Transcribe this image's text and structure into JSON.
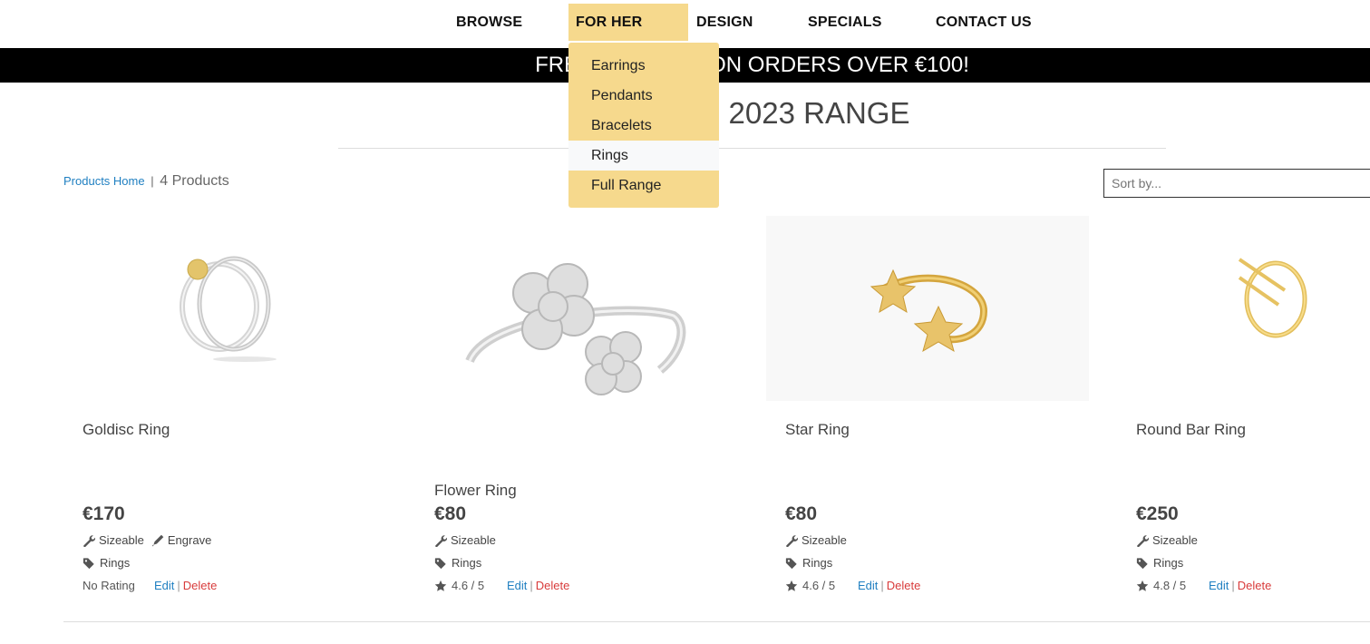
{
  "nav": {
    "items": [
      "BROWSE",
      "FOR HER",
      "DESIGN",
      "SPECIALS",
      "CONTACT US"
    ]
  },
  "dropdown": {
    "items": [
      "Earrings",
      "Pendants",
      "Bracelets",
      "Rings",
      "Full Range"
    ],
    "active": "Rings"
  },
  "banner": {
    "text": "FREE SHIPPING ON ORDERS OVER €100!"
  },
  "range": {
    "title": "2023 RANGE"
  },
  "breadcrumb": {
    "link": "Products Home",
    "sep": "|",
    "count": "4 Products"
  },
  "sort": {
    "placeholder": "Sort by..."
  },
  "actions": {
    "edit": "Edit",
    "sep": "|",
    "delete": "Delete"
  },
  "products": [
    {
      "name": "Goldisc Ring",
      "price": "€170",
      "features": [
        "Sizeable",
        "Engrave"
      ],
      "category": "Rings",
      "rating": "No Rating"
    },
    {
      "name": "Flower Ring",
      "price": "€80",
      "features": [
        "Sizeable"
      ],
      "category": "Rings",
      "rating": "4.6 / 5"
    },
    {
      "name": "Star Ring",
      "price": "€80",
      "features": [
        "Sizeable"
      ],
      "category": "Rings",
      "rating": "4.6 / 5"
    },
    {
      "name": "Round Bar Ring",
      "price": "€250",
      "features": [
        "Sizeable"
      ],
      "category": "Rings",
      "rating": "4.8 / 5"
    }
  ],
  "colors": {
    "accent": "#f6d98d",
    "link": "#1f7fc1",
    "delete": "#d83b3b",
    "banner": "#000000"
  }
}
